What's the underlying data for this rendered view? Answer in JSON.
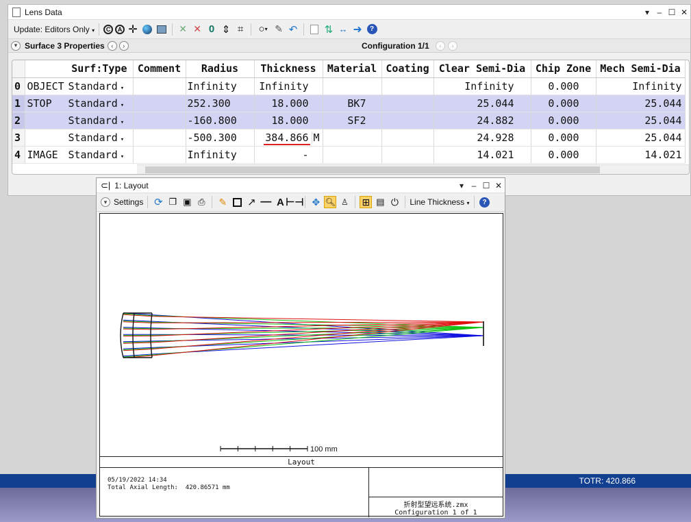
{
  "lens_window": {
    "title": "Lens Data",
    "update_label": "Update: Editors Only",
    "surface_props": "Surface 3 Properties",
    "configuration": "Configuration 1/1",
    "columns": [
      "Surf:Type",
      "Comment",
      "Radius",
      "Thickness",
      "Material",
      "Coating",
      "Clear Semi-Dia",
      "Chip Zone",
      "Mech Semi-Dia"
    ],
    "rows": [
      {
        "num": "0",
        "name": "OBJECT",
        "type": "Standard",
        "comment": "",
        "radius": "Infinity",
        "thickness": "Infinity",
        "thk_flag": "",
        "material": "",
        "coating": "",
        "clear": "Infinity",
        "chip": "0.000",
        "mech": "Infinity"
      },
      {
        "num": "1",
        "name": "STOP",
        "type": "Standard",
        "comment": "",
        "radius": "252.300",
        "thickness": "18.000",
        "thk_flag": "",
        "material": "BK7",
        "coating": "",
        "clear": "25.044",
        "chip": "0.000",
        "mech": "25.044"
      },
      {
        "num": "2",
        "name": "",
        "type": "Standard",
        "comment": "",
        "radius": "-160.800",
        "thickness": "18.000",
        "thk_flag": "",
        "material": "SF2",
        "coating": "",
        "clear": "24.882",
        "chip": "0.000",
        "mech": "25.044"
      },
      {
        "num": "3",
        "name": "",
        "type": "Standard",
        "comment": "",
        "radius": "-500.300",
        "thickness": "384.866",
        "thk_flag": "M",
        "material": "",
        "coating": "",
        "clear": "24.928",
        "chip": "0.000",
        "mech": "25.044"
      },
      {
        "num": "4",
        "name": "IMAGE",
        "type": "Standard",
        "comment": "",
        "radius": "Infinity",
        "thickness": "-",
        "thk_flag": "",
        "material": "",
        "coating": "",
        "clear": "14.021",
        "chip": "0.000",
        "mech": "14.021"
      }
    ]
  },
  "status": {
    "totr": "TOTR: 420.866"
  },
  "layout_window": {
    "title": "1: Layout",
    "settings_label": "Settings",
    "line_thickness_label": "Line Thickness",
    "scale_label": "100 mm",
    "plot_title": "Layout",
    "date": "05/19/2022 14:34",
    "total_length": "Total Axial Length:  420.86571 mm",
    "file_name": "折射型望远系统.zmx",
    "config_text": "Configuration 1 of 1"
  },
  "colors": {
    "field1": "#1010e0",
    "field2": "#10c010",
    "field3": "#e01010",
    "selection": "#d3d3f3",
    "statusbar": "#123f8f"
  }
}
